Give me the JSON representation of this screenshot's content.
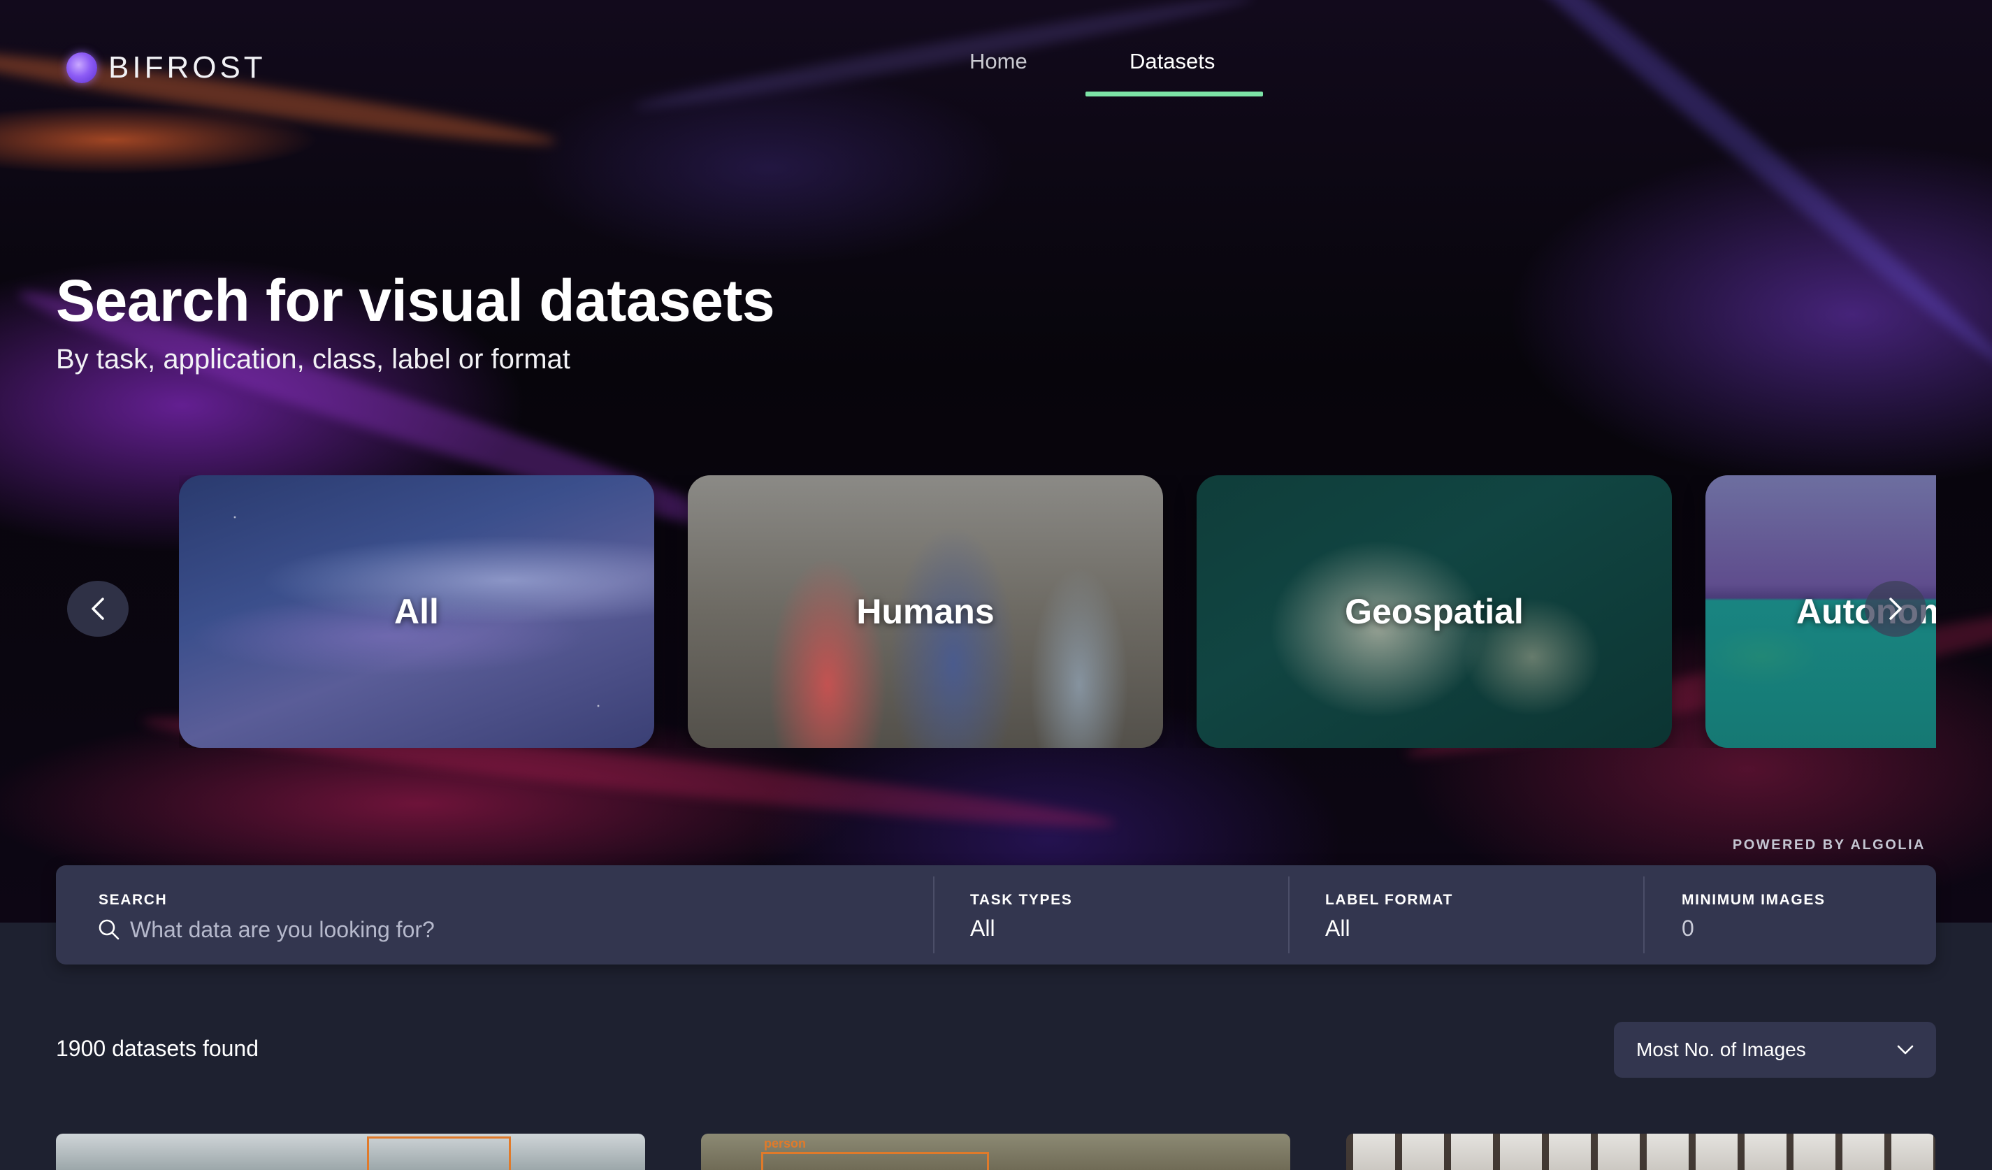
{
  "app": {
    "name": "BIFROST"
  },
  "nav": {
    "items": [
      {
        "label": "Home",
        "active": false
      },
      {
        "label": "Datasets",
        "active": true
      }
    ],
    "accent_color": "#7ce3a6"
  },
  "hero": {
    "title": "Search for visual datasets",
    "subtitle": "By task, application, class, label or format"
  },
  "carousel": {
    "prev_icon": "chevron-left-icon",
    "next_icon": "chevron-right-icon",
    "cards": [
      {
        "label": "All"
      },
      {
        "label": "Humans"
      },
      {
        "label": "Geospatial"
      },
      {
        "label": "Autonomous Vehicles"
      }
    ]
  },
  "search": {
    "powered_by": "POWERED BY ALGOLIA",
    "search_label": "SEARCH",
    "search_placeholder": "What data are you looking for?",
    "task_types_label": "TASK TYPES",
    "task_types_value": "All",
    "label_format_label": "LABEL FORMAT",
    "label_format_value": "All",
    "min_images_label": "MINIMUM IMAGES",
    "min_images_value": "0"
  },
  "results": {
    "count_text": "1900 datasets found",
    "sort": {
      "selected": "Most No. of Images"
    },
    "preview_tags": [
      "person"
    ]
  }
}
